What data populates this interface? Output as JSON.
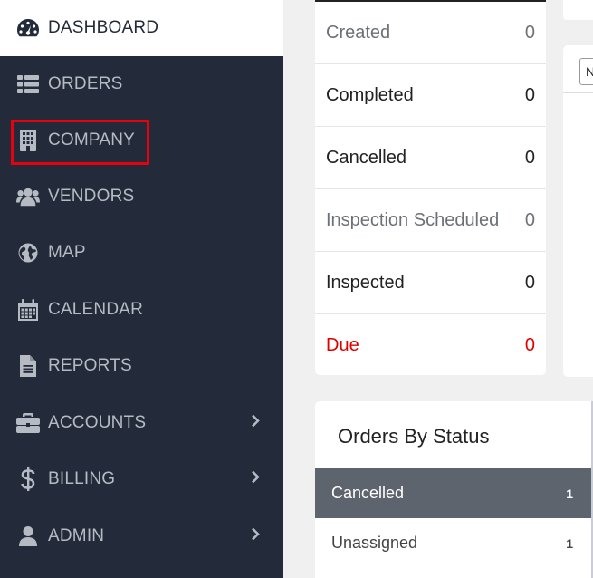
{
  "sidebar": {
    "items": [
      {
        "label": "DASHBOARD",
        "icon": "dashboard-gauge-icon",
        "active": true
      },
      {
        "label": "ORDERS",
        "icon": "list-icon"
      },
      {
        "label": "COMPANY",
        "icon": "building-icon"
      },
      {
        "label": "VENDORS",
        "icon": "users-icon"
      },
      {
        "label": "MAP",
        "icon": "globe-icon"
      },
      {
        "label": "CALENDAR",
        "icon": "calendar-icon"
      },
      {
        "label": "REPORTS",
        "icon": "file-icon"
      },
      {
        "label": "ACCOUNTS",
        "icon": "briefcase-icon",
        "has_submenu": true
      },
      {
        "label": "BILLING",
        "icon": "dollar-icon",
        "has_submenu": true
      },
      {
        "label": "ADMIN",
        "icon": "user-icon",
        "has_submenu": true
      }
    ]
  },
  "status_summary": {
    "rows": [
      {
        "label": "Created",
        "value": "0",
        "style": "muted"
      },
      {
        "label": "Completed",
        "value": "0",
        "style": "normal"
      },
      {
        "label": "Cancelled",
        "value": "0",
        "style": "normal"
      },
      {
        "label": "Inspection Scheduled",
        "value": "0",
        "style": "muted"
      },
      {
        "label": "Inspected",
        "value": "0",
        "style": "normal"
      },
      {
        "label": "Due",
        "value": "0",
        "style": "due"
      }
    ]
  },
  "right_panel": {
    "select_value": "N"
  },
  "orders_by_status": {
    "title": "Orders By Status",
    "rows": [
      {
        "label": "Cancelled",
        "count": "1",
        "selected": true
      },
      {
        "label": "Unassigned",
        "count": "1",
        "selected": false
      }
    ]
  },
  "colors": {
    "sidebar_bg": "#232b3b",
    "highlight": "#e8000a",
    "due": "#e00000",
    "selected_row": "#5e646d"
  }
}
